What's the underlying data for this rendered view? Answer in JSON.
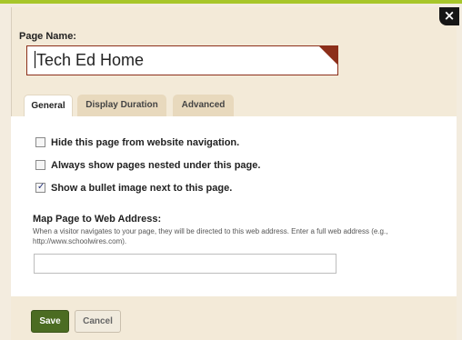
{
  "dialog": {
    "close_label": "×"
  },
  "page_name": {
    "label": "Page Name:",
    "value": "Tech Ed Home"
  },
  "tabs": [
    {
      "label": "General",
      "active": true
    },
    {
      "label": "Display Duration",
      "active": false
    },
    {
      "label": "Advanced",
      "active": false
    }
  ],
  "general": {
    "options": [
      {
        "label": "Hide this page from website navigation.",
        "checked": false
      },
      {
        "label": "Always show pages nested under this page.",
        "checked": false
      },
      {
        "label": "Show a bullet image next to this page.",
        "checked": true
      }
    ],
    "map": {
      "label": "Map Page to Web Address:",
      "description": "When a visitor navigates to your page, they will be directed to this web address. Enter a full web address (e.g., http://www.schoolwires.com).",
      "value": ""
    }
  },
  "footer": {
    "save_label": "Save",
    "cancel_label": "Cancel"
  },
  "colors": {
    "accent": "#a7c62a",
    "save_button": "#4b6c22",
    "field_border": "#8c2f1a"
  }
}
